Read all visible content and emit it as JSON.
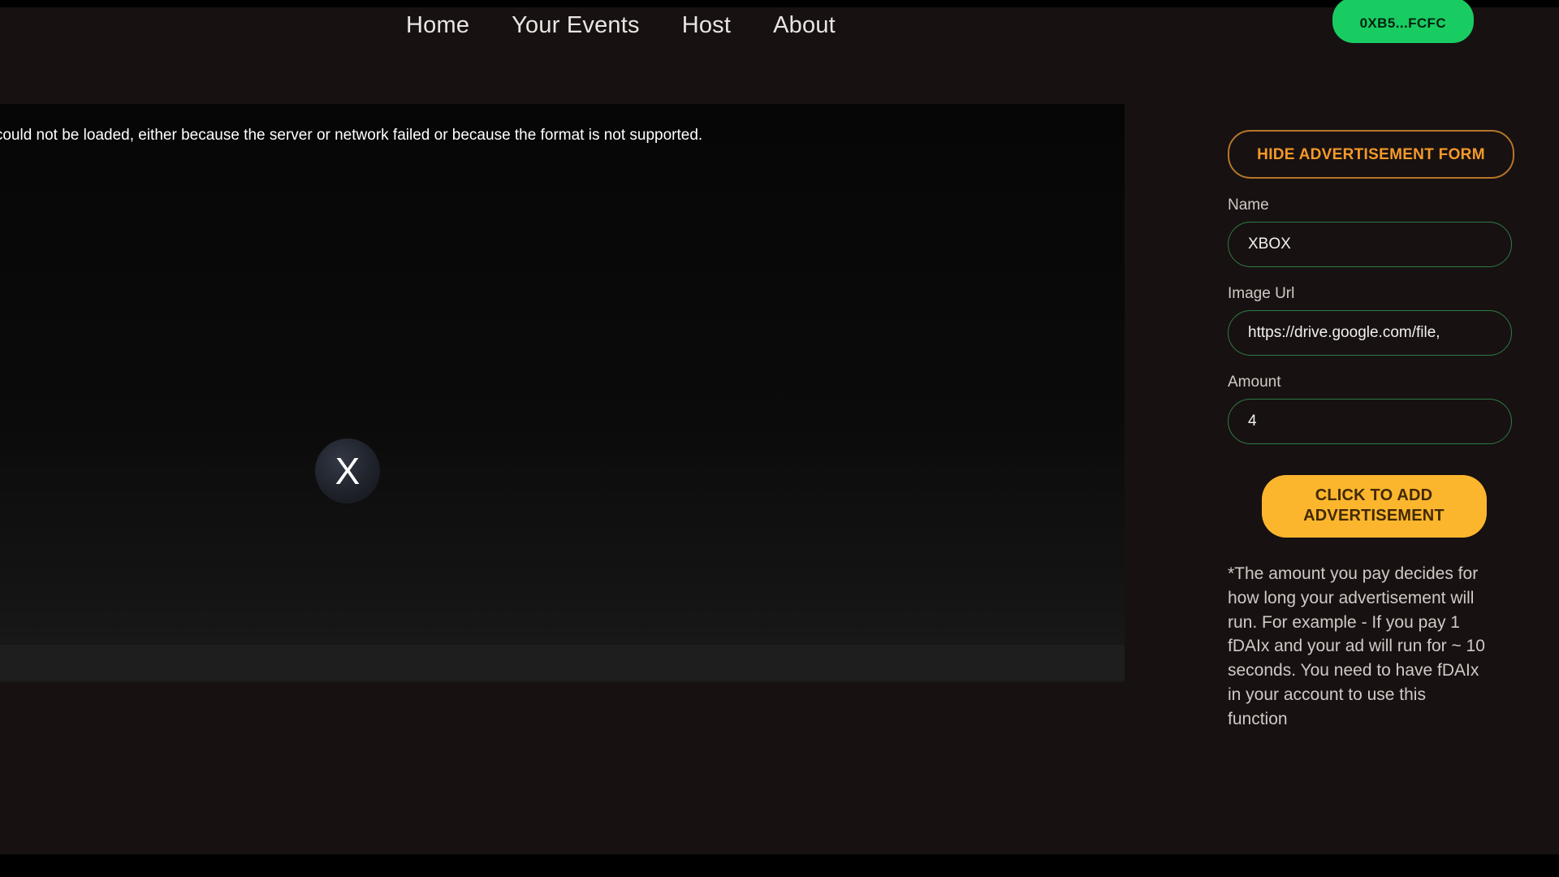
{
  "theme": {
    "page_bg": "#171111",
    "accent_green": "#18cc62",
    "accent_amber": "#fcb62e",
    "accent_orange": "#f59a28",
    "input_border_green": "#2f7a46"
  },
  "nav": {
    "links": [
      {
        "label": "Home"
      },
      {
        "label": "Your Events"
      },
      {
        "label": "Host"
      },
      {
        "label": "About"
      }
    ],
    "wallet_button": "0XB5...FCFC"
  },
  "video": {
    "error_text": "a could not be loaded, either because the server or network failed or because the format is not supported.",
    "error_icon": "x-circle-icon"
  },
  "ad_form": {
    "toggle_button": "HIDE ADVERTISEMENT FORM",
    "fields": [
      {
        "label": "Name",
        "value": "XBOX",
        "placeholder": "Name"
      },
      {
        "label": "Image Url",
        "value": "https://drive.google.com/file,",
        "placeholder": "Image Url"
      },
      {
        "label": "Amount",
        "value": "4",
        "placeholder": "Amount"
      }
    ],
    "submit_button": "CLICK TO ADD ADVERTISEMENT",
    "help_note": "*The amount you pay decides for how long your advertisement will run. For example - If you pay 1 fDAIx and your ad will run for ~ 10 seconds. You need to have fDAIx in your account to use this function"
  }
}
